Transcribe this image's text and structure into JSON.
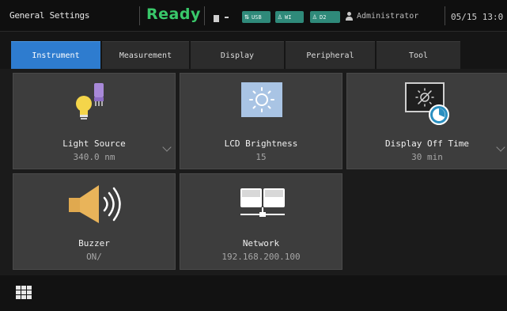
{
  "header": {
    "title": "General Settings",
    "status": "Ready",
    "status_color": "#39c86a",
    "indicators": [
      {
        "icon": "usb-icon",
        "label": "USB"
      },
      {
        "icon": "wifi-person-icon",
        "label": "WI"
      },
      {
        "icon": "d2-person-icon",
        "label": "D2"
      }
    ],
    "user": "Administrator",
    "datetime": "05/15 13:0"
  },
  "tabs": [
    {
      "label": "Instrument",
      "active": true
    },
    {
      "label": "Measurement",
      "active": false
    },
    {
      "label": "Display",
      "active": false
    },
    {
      "label": "Peripheral",
      "active": false
    },
    {
      "label": "Tool",
      "active": false
    }
  ],
  "tiles": {
    "light_source": {
      "label": "Light Source",
      "value": "340.0 nm",
      "icon": "lamp-icon"
    },
    "lcd_brightness": {
      "label": "LCD Brightness",
      "value": "15",
      "icon": "brightness-icon"
    },
    "display_off_time": {
      "label": "Display Off Time",
      "value": "30 min",
      "icon": "display-timer-icon"
    },
    "buzzer": {
      "label": "Buzzer",
      "value": "ON/",
      "icon": "speaker-icon"
    },
    "network": {
      "label": "Network",
      "value": "192.168.200.100",
      "icon": "network-icon"
    }
  },
  "accent_color": "#2e7ccf"
}
